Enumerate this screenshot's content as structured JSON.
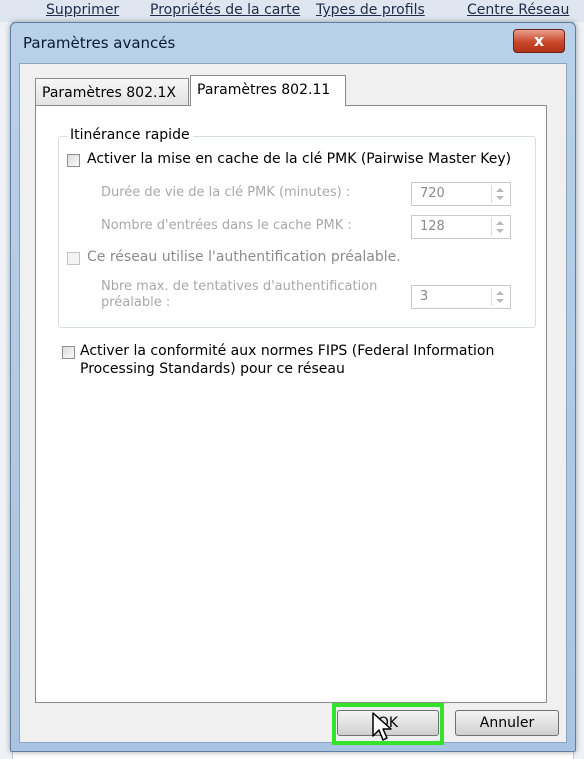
{
  "background_menu": {
    "items": [
      "Supprimer",
      "Propriétés de la carte",
      "Types de profils",
      "Centre Réseau"
    ]
  },
  "dialog": {
    "title": "Paramètres avancés",
    "close_symbol": "x"
  },
  "tabs": [
    {
      "label": "Paramètres 802.1X",
      "active": false
    },
    {
      "label": "Paramètres 802.11",
      "active": true
    }
  ],
  "fast_roaming": {
    "group_label": "Itinérance rapide",
    "pmk_cache": {
      "label": "Activer la mise en cache de la clé PMK (Pairwise Master Key)",
      "checked": false
    },
    "pmk_lifetime": {
      "label": "Durée de vie de la clé PMK (minutes) :",
      "value": "720"
    },
    "pmk_entries": {
      "label": "Nombre d'entrées dans le cache PMK :",
      "value": "128"
    },
    "preauth": {
      "label": "Ce réseau utilise l'authentification préalable.",
      "checked": false
    },
    "preauth_attempts": {
      "label_line1": "Nbre max. de tentatives d'authentification",
      "label_line2": "préalable :",
      "value": "3"
    }
  },
  "fips": {
    "label_line1": "Activer la conformité aux normes FIPS (Federal Information",
    "label_line2": "Processing Standards) pour ce réseau",
    "checked": false
  },
  "buttons": {
    "ok": "OK",
    "cancel": "Annuler"
  },
  "colors": {
    "highlight": "#33e22a",
    "title_bar": "#b9d1ea",
    "close_button": "#c9472b"
  },
  "icons": {
    "close": "close-icon",
    "cursor": "mouse-pointer-icon",
    "spin_up": "spin-up-arrow-icon",
    "spin_down": "spin-down-arrow-icon"
  }
}
